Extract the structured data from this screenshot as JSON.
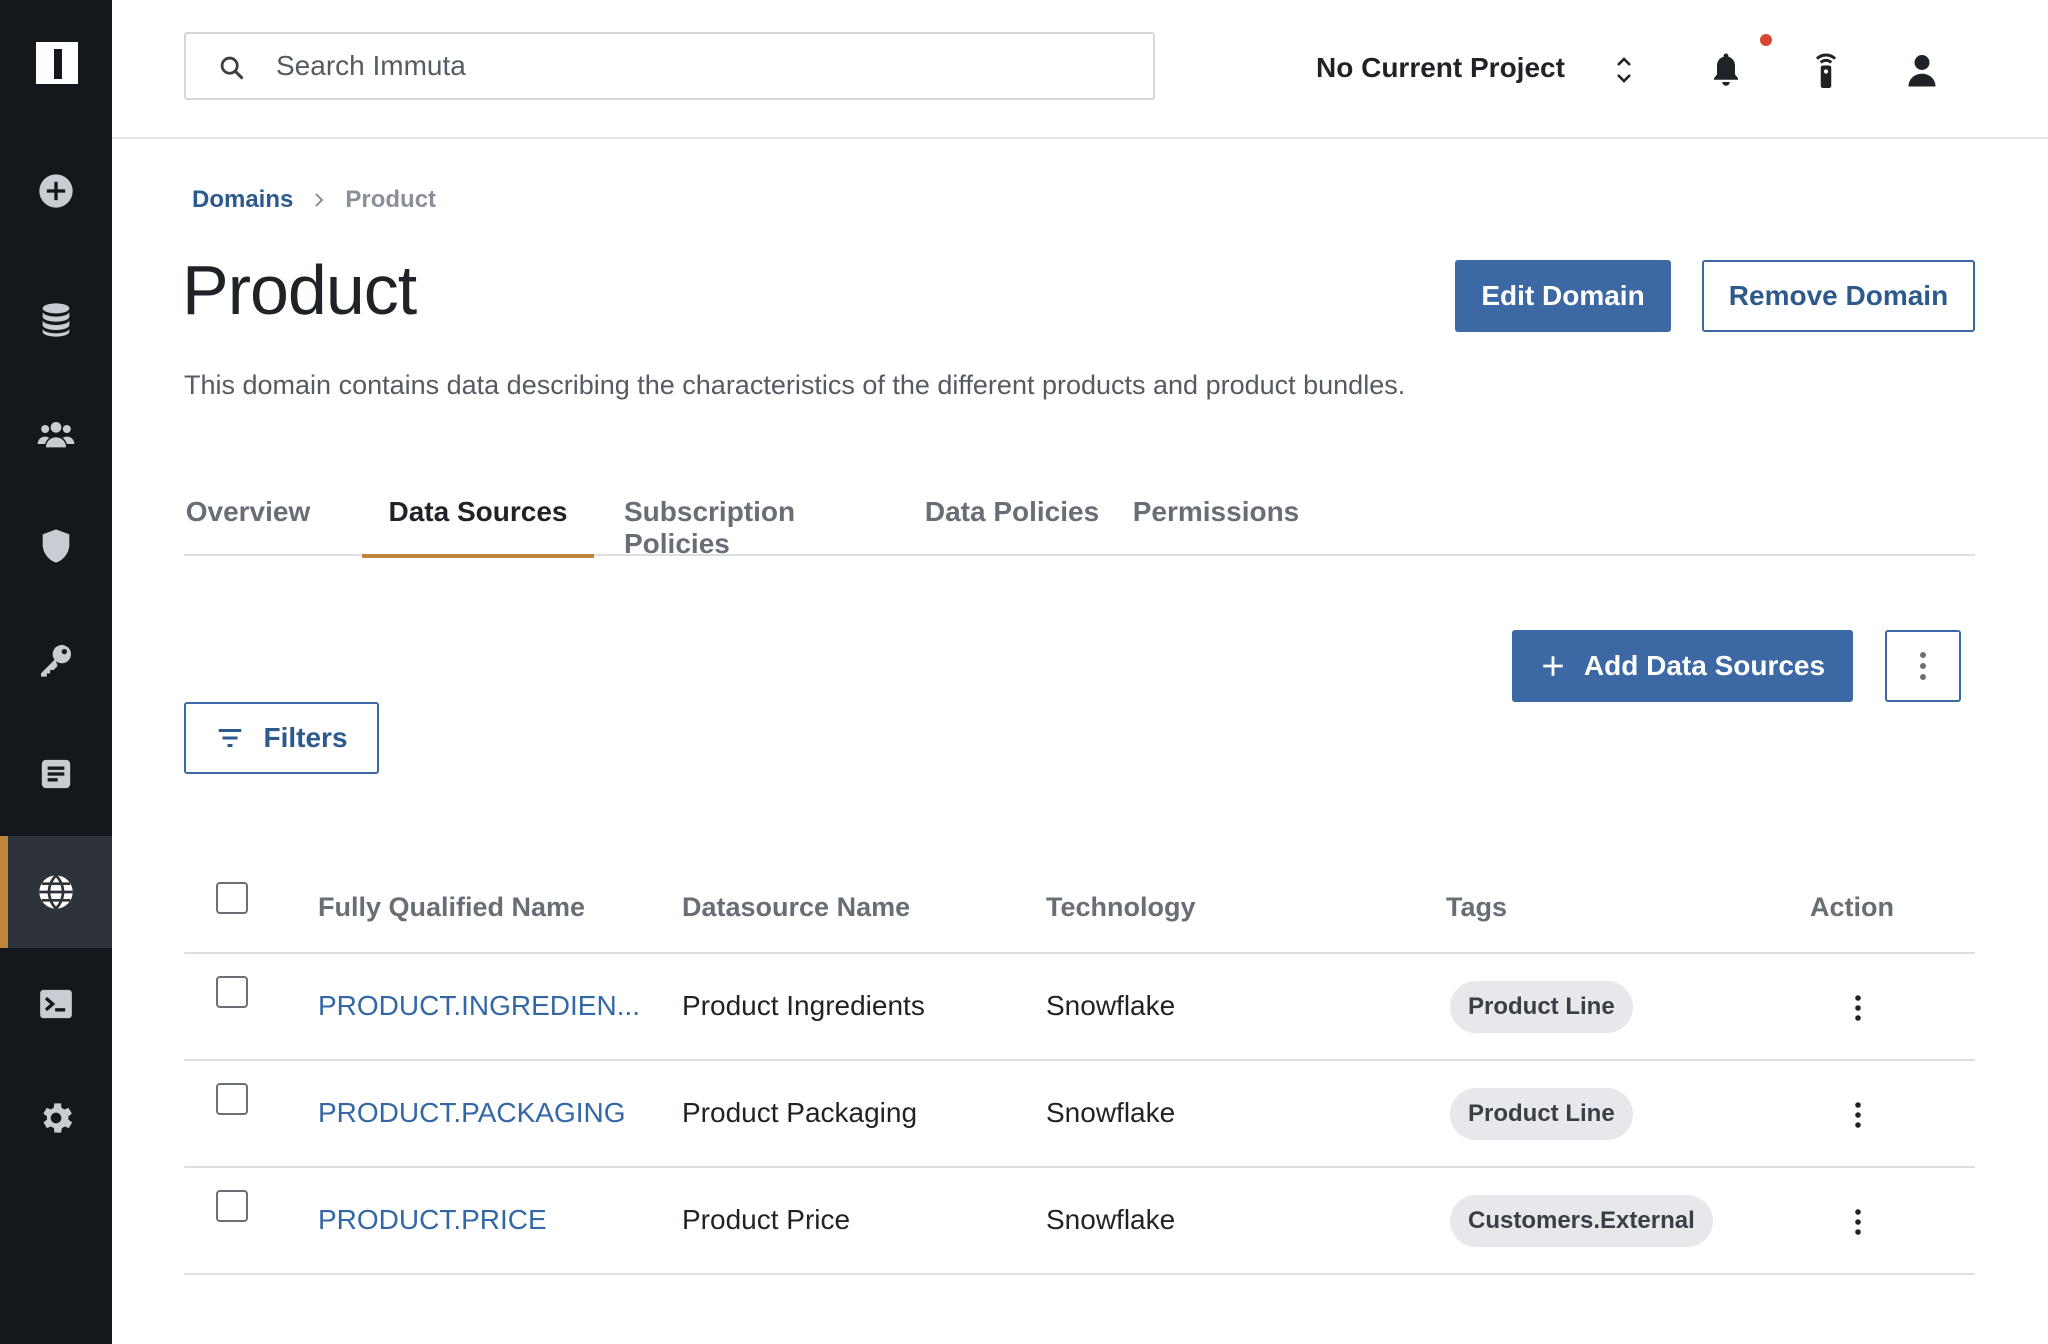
{
  "search": {
    "placeholder": "Search Immuta"
  },
  "header": {
    "project": "No Current Project"
  },
  "sidebar": {
    "items": [
      {
        "icon": "plus-circle-icon"
      },
      {
        "icon": "database-icon"
      },
      {
        "icon": "users-icon"
      },
      {
        "icon": "shield-icon"
      },
      {
        "icon": "key-icon"
      },
      {
        "icon": "document-icon"
      },
      {
        "icon": "globe-icon",
        "active": true
      },
      {
        "icon": "terminal-icon"
      },
      {
        "icon": "gear-icon"
      }
    ]
  },
  "breadcrumb": {
    "parent": "Domains",
    "current": "Product"
  },
  "page": {
    "title": "Product",
    "description": "This domain contains data describing the characteristics of the different products and product bundles.",
    "edit_label": "Edit Domain",
    "remove_label": "Remove Domain"
  },
  "tabs": [
    {
      "label": "Overview"
    },
    {
      "label": "Data Sources",
      "active": true
    },
    {
      "label": "Subscription Policies"
    },
    {
      "label": "Data Policies"
    },
    {
      "label": "Permissions"
    }
  ],
  "toolbar": {
    "add_label": "Add Data Sources",
    "filters_label": "Filters"
  },
  "table": {
    "headers": {
      "fqn": "Fully Qualified Name",
      "name": "Datasource Name",
      "tech": "Technology",
      "tags": "Tags",
      "action": "Action"
    },
    "rows": [
      {
        "fqn": "PRODUCT.INGREDIEN...",
        "name": "Product Ingredients",
        "tech": "Snowflake",
        "tag": "Product Line"
      },
      {
        "fqn": "PRODUCT.PACKAGING",
        "name": "Product Packaging",
        "tech": "Snowflake",
        "tag": "Product Line"
      },
      {
        "fqn": "PRODUCT.PRICE",
        "name": "Product Price",
        "tech": "Snowflake",
        "tag": "Customers.External"
      }
    ]
  },
  "colors": {
    "sidebar_bg": "#14171c",
    "accent": "#c0853d",
    "primary": "#3c69a3",
    "link": "#3467a6",
    "notification": "#d2492f"
  }
}
